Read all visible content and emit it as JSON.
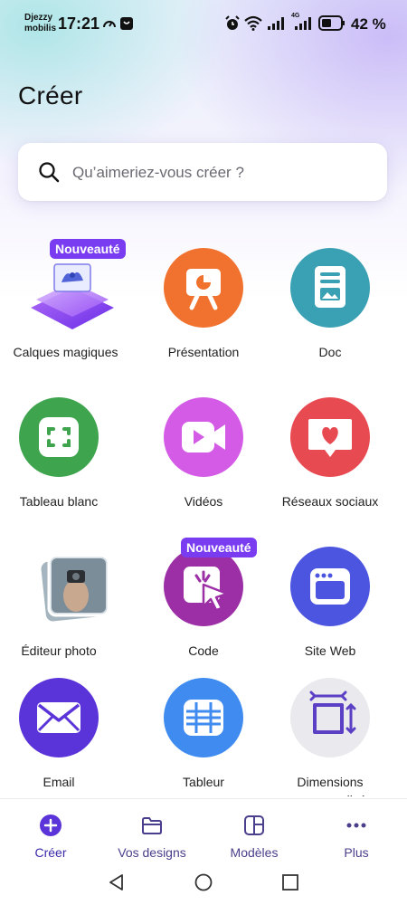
{
  "status_bar": {
    "carrier_line1": "Djezzy",
    "carrier_line2": "mobilis",
    "time": "17:21",
    "network": "4G",
    "battery_percent": "42 %"
  },
  "page_title": "Créer",
  "search": {
    "placeholder": "Qu’aimeriez-vous créer ?"
  },
  "badge_new": "Nouveauté",
  "tiles": [
    {
      "label": "Calques magiques",
      "icon": "magic-layers-icon",
      "color": "#8b3ff0",
      "badge": true
    },
    {
      "label": "Présentation",
      "icon": "presentation-icon",
      "color": "#f0722e"
    },
    {
      "label": "Doc",
      "icon": "doc-icon",
      "color": "#3aa0b3"
    },
    {
      "label": "Tableau blanc",
      "icon": "whiteboard-icon",
      "color": "#3ea44d"
    },
    {
      "label": "Vidéos",
      "icon": "video-icon",
      "color": "#d35be6"
    },
    {
      "label": "Réseaux sociaux",
      "icon": "social-heart-icon",
      "color": "#e84a52"
    },
    {
      "label": "Éditeur photo",
      "icon": "photo-editor-icon",
      "color": "#888888"
    },
    {
      "label": "Code",
      "icon": "code-cursor-icon",
      "color": "#9c2fa6",
      "badge": true
    },
    {
      "label": "Site Web",
      "icon": "website-icon",
      "color": "#4b55e0"
    },
    {
      "label": "Email",
      "icon": "email-icon",
      "color": "#5b34d9"
    },
    {
      "label": "Tableur",
      "icon": "spreadsheet-icon",
      "color": "#3f8bf0"
    },
    {
      "label": "Dimensions personnalisé",
      "icon": "custom-size-icon",
      "color": "#e9e9ee"
    }
  ],
  "nav": {
    "create": "Créer",
    "designs": "Vos designs",
    "templates": "Modèles",
    "more": "Plus"
  }
}
